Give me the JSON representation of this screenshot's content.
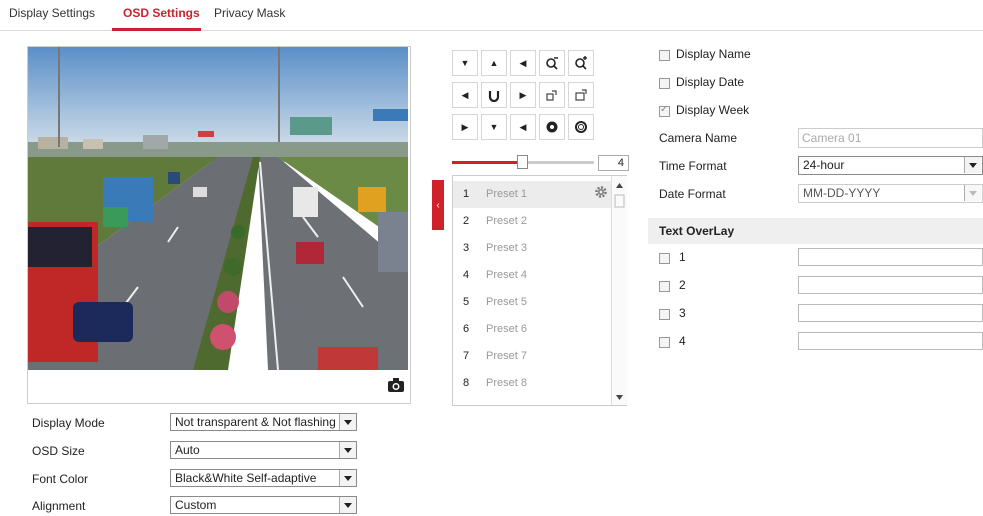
{
  "tabs": [
    {
      "label": "Display Settings",
      "active": false
    },
    {
      "label": "OSD Settings",
      "active": true
    },
    {
      "label": "Privacy Mask",
      "active": false
    }
  ],
  "accent_color": "#c8242f",
  "preview": {
    "camera_icon": "camera-icon"
  },
  "osd_options": {
    "display_mode": {
      "label": "Display Mode",
      "value": "Not transparent & Not flashing"
    },
    "osd_size": {
      "label": "OSD Size",
      "value": "Auto"
    },
    "font_color": {
      "label": "Font Color",
      "value": "Black&White Self-adaptive"
    },
    "alignment": {
      "label": "Alignment",
      "value": "Custom"
    }
  },
  "ptz": {
    "buttons": [
      "down-left-arrow-icon",
      "up-arrow-icon",
      "up-left-arrow-icon",
      "zoom-in-icon",
      "zoom-out-icon",
      "left-arrow-icon",
      "auto-rotate-icon",
      "right-arrow-icon",
      "focus-near-icon",
      "focus-far-icon",
      "up-right-arrow-icon",
      "down-arrow-icon",
      "down-right-arrow-icon",
      "iris-open-icon",
      "iris-close-icon"
    ],
    "speed_value": "4",
    "speed_fraction": 0.48,
    "presets": [
      {
        "num": "1",
        "name": "Preset 1"
      },
      {
        "num": "2",
        "name": "Preset 2"
      },
      {
        "num": "3",
        "name": "Preset 3"
      },
      {
        "num": "4",
        "name": "Preset 4"
      },
      {
        "num": "5",
        "name": "Preset 5"
      },
      {
        "num": "6",
        "name": "Preset 6"
      },
      {
        "num": "7",
        "name": "Preset 7"
      },
      {
        "num": "8",
        "name": "Preset 8"
      }
    ]
  },
  "display_info": {
    "display_name": {
      "label": "Display Name",
      "checked": false
    },
    "display_date": {
      "label": "Display Date",
      "checked": false
    },
    "display_week": {
      "label": "Display Week",
      "checked": true
    },
    "camera_name": {
      "label": "Camera Name",
      "value": "Camera 01"
    },
    "time_format": {
      "label": "Time Format",
      "value": "24-hour"
    },
    "date_format": {
      "label": "Date Format",
      "value": "MM-DD-YYYY"
    }
  },
  "text_overlay": {
    "title": "Text OverLay",
    "items": [
      {
        "label": "1",
        "value": ""
      },
      {
        "label": "2",
        "value": ""
      },
      {
        "label": "3",
        "value": ""
      },
      {
        "label": "4",
        "value": ""
      }
    ]
  }
}
